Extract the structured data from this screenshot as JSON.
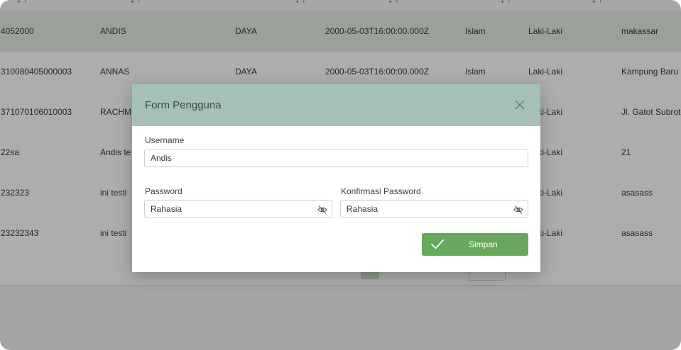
{
  "table": {
    "rows": [
      {
        "id": "4052000",
        "name": "ANDIS",
        "area": "DAYA",
        "date": "2000-05-03T16:00:00.000Z",
        "religion": "Islam",
        "gender": "Laki-Laki",
        "address": "makassar"
      },
      {
        "id": "310080405000003",
        "name": "ANNAS",
        "area": "DAYA",
        "date": "2000-05-03T16:00:00.000Z",
        "religion": "Islam",
        "gender": "Laki-Laki",
        "address": "Kampung Baru"
      },
      {
        "id": "371070106010003",
        "name": "RACHM",
        "area": "",
        "date": "",
        "religion": "",
        "gender": "Laki-Laki",
        "address": "Jl. Gatot Subroto"
      },
      {
        "id": "22sa",
        "name": "Andis te",
        "area": "",
        "date": "",
        "religion": "",
        "gender": "Laki-Laki",
        "address": "21"
      },
      {
        "id": "232323",
        "name": "ini testi",
        "area": "",
        "date": "",
        "religion": "",
        "gender": "Laki-Laki",
        "address": "asasass"
      },
      {
        "id": "23232343",
        "name": "ini testi",
        "area": "",
        "date": "",
        "religion": "",
        "gender": "Laki-Laki",
        "address": "asasass"
      }
    ]
  },
  "modal": {
    "title": "Form Pengguna",
    "username_label": "Username",
    "username_value": "Andis",
    "password_label": "Password",
    "password_value": "Rahasia",
    "confirm_label": "Konfirmasi Password",
    "confirm_value": "Rahasia",
    "save_label": "Simpan"
  },
  "colors": {
    "modal_header": "#a6c0b8",
    "save_button": "#67a85b",
    "highlight_row": "#e2ede0"
  },
  "icons": {
    "close": "close-icon",
    "eye": "eye-off-icon",
    "check": "check-icon"
  }
}
